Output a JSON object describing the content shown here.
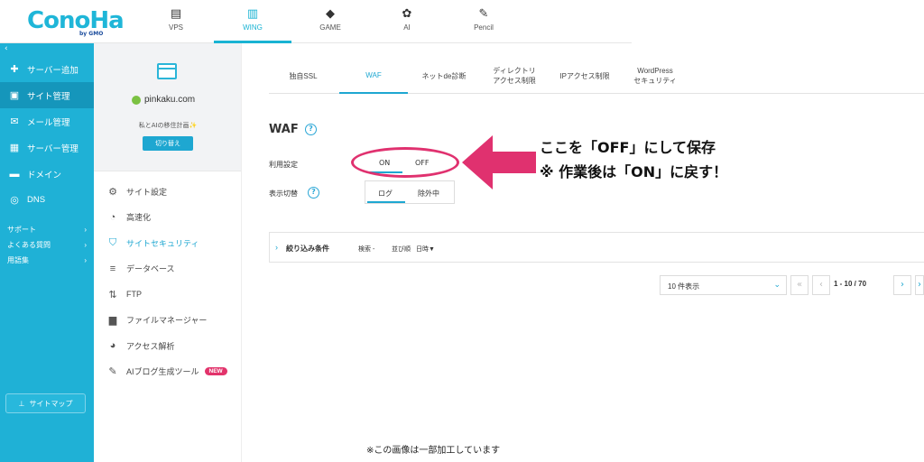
{
  "brand": {
    "logo": "ConoHa",
    "sub": "by GMO"
  },
  "topnav": [
    {
      "label": "VPS",
      "icon": "server-icon"
    },
    {
      "label": "WING",
      "icon": "wing-icon"
    },
    {
      "label": "GAME",
      "icon": "gamepad-icon"
    },
    {
      "label": "AI",
      "icon": "ai-icon"
    },
    {
      "label": "Pencil",
      "icon": "pencil-icon"
    }
  ],
  "sidebar": {
    "collapse": "‹",
    "items": [
      {
        "label": "サーバー追加",
        "icon": "plus-icon"
      },
      {
        "label": "サイト管理",
        "icon": "site-icon"
      },
      {
        "label": "メール管理",
        "icon": "mail-icon"
      },
      {
        "label": "サーバー管理",
        "icon": "server-icon"
      },
      {
        "label": "ドメイン",
        "icon": "domain-icon"
      },
      {
        "label": "DNS",
        "icon": "globe-icon"
      }
    ],
    "subs": [
      {
        "label": "サポート"
      },
      {
        "label": "よくある質問"
      },
      {
        "label": "用語集"
      }
    ],
    "sitemap": "サイトマップ"
  },
  "site": {
    "domain": "pinkaku.com",
    "note": "私とAIの移住計画✨",
    "switch_label": "切り替え"
  },
  "menu": [
    {
      "label": "サイト設定",
      "icon": "settings-icon"
    },
    {
      "label": "高速化",
      "icon": "speed-icon"
    },
    {
      "label": "サイトセキュリティ",
      "icon": "shield-icon"
    },
    {
      "label": "データベース",
      "icon": "database-icon"
    },
    {
      "label": "FTP",
      "icon": "transfer-icon"
    },
    {
      "label": "ファイルマネージャー",
      "icon": "folder-icon"
    },
    {
      "label": "アクセス解析",
      "icon": "pie-icon"
    },
    {
      "label": "AIブログ生成ツール",
      "icon": "doc-icon",
      "badge": "NEW"
    }
  ],
  "tabs": [
    {
      "label": "独自SSL"
    },
    {
      "label": "WAF"
    },
    {
      "label": "ネットde診断"
    },
    {
      "label1": "ディレクトリ",
      "label2": "アクセス制限"
    },
    {
      "label": "IPアクセス制限"
    },
    {
      "label1": "WordPress",
      "label2": "セキュリティ"
    }
  ],
  "waf": {
    "title": "WAF",
    "usage_label": "利用設定",
    "on": "ON",
    "off": "OFF",
    "display_label": "表示切替",
    "log": "ログ",
    "exclude": "除外中"
  },
  "filter": {
    "label": "絞り込み条件",
    "search": "検索 -",
    "sort": "並び順",
    "sort_value": "日時▼"
  },
  "pagination": {
    "per_page": "10 件表示",
    "range": "1 - 10 / 70"
  },
  "annotation": {
    "line1": "ここを「OFF」にして保存",
    "line2": "※ 作業後は「ON」に戻す！"
  },
  "footnote": "※この画像は一部加工しています",
  "colors": {
    "brand": "#1fb1d6",
    "accent": "#1ea7d1",
    "highlight": "#e0316f"
  }
}
